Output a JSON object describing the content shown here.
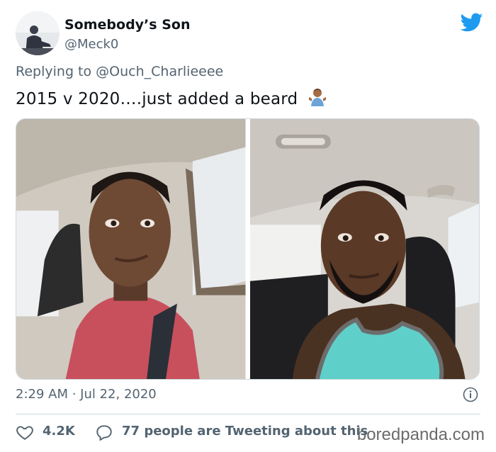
{
  "author": {
    "display_name": "Somebody’s Son",
    "handle": "@Meck0",
    "avatar_icon": "profile-photo"
  },
  "brand": {
    "icon": "twitter-bird-icon",
    "color": "#1d9bf0"
  },
  "reply": {
    "prefix": "Replying to ",
    "mention": "@Ouch_Charlieeee"
  },
  "tweet": {
    "text": "2015 v 2020….just added a beard",
    "emoji": "man-shrugging-emoji"
  },
  "media": [
    {
      "name": "photo-2015"
    },
    {
      "name": "photo-2020"
    }
  ],
  "meta": {
    "timestamp": "2:29 AM · Jul 22, 2020",
    "info_icon": "info-icon"
  },
  "engagement": {
    "likes": "4.2K",
    "replies_text": "77 people are Tweeting about this"
  },
  "watermark": "boredpanda.com"
}
